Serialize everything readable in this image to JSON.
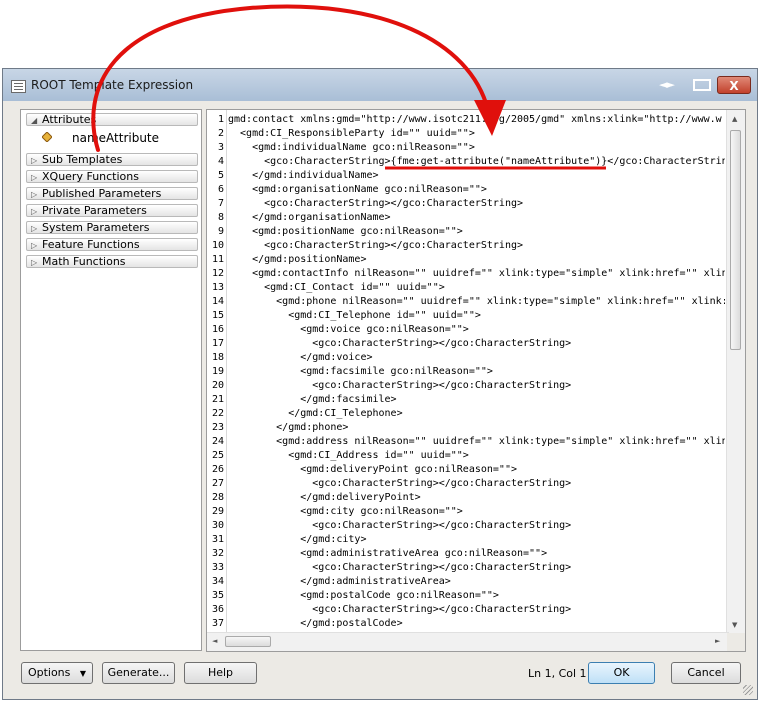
{
  "window": {
    "title": "ROOT Template Expression",
    "nav_arrows": "◄►",
    "close_label": "X"
  },
  "left_panel": {
    "categories": [
      {
        "label": "Attributes",
        "expanded": true
      },
      {
        "label": "Sub Templates",
        "expanded": false
      },
      {
        "label": "XQuery Functions",
        "expanded": false
      },
      {
        "label": "Published Parameters",
        "expanded": false
      },
      {
        "label": "Private Parameters",
        "expanded": false
      },
      {
        "label": "System Parameters",
        "expanded": false
      },
      {
        "label": "Feature Functions",
        "expanded": false
      },
      {
        "label": "Math Functions",
        "expanded": false
      }
    ],
    "attribute_items": [
      {
        "label": "nameAttribute",
        "icon": "attribute-diamond-icon"
      }
    ]
  },
  "editor": {
    "line_numbers": [
      "1",
      "2",
      "3",
      "4",
      "5",
      "6",
      "7",
      "8",
      "9",
      "10",
      "11",
      "12",
      "13",
      "14",
      "15",
      "16",
      "17",
      "18",
      "19",
      "20",
      "21",
      "22",
      "23",
      "24",
      "25",
      "26",
      "27",
      "28",
      "29",
      "30",
      "31",
      "32",
      "33",
      "34",
      "35",
      "36",
      "37"
    ],
    "lines": [
      "gmd:contact xmlns:gmd=\"http://www.isotc211.org/2005/gmd\" xmlns:xlink=\"http://www.w",
      "  <gmd:CI_ResponsibleParty id=\"\" uuid=\"\">",
      "    <gmd:individualName gco:nilReason=\"\">",
      "      <gco:CharacterString>{fme:get-attribute(\"nameAttribute\")}</gco:CharacterStrin",
      "    </gmd:individualName>",
      "    <gmd:organisationName gco:nilReason=\"\">",
      "      <gco:CharacterString></gco:CharacterString>",
      "    </gmd:organisationName>",
      "    <gmd:positionName gco:nilReason=\"\">",
      "      <gco:CharacterString></gco:CharacterString>",
      "    </gmd:positionName>",
      "    <gmd:contactInfo nilReason=\"\" uuidref=\"\" xlink:type=\"simple\" xlink:href=\"\" xlin",
      "      <gmd:CI_Contact id=\"\" uuid=\"\">",
      "        <gmd:phone nilReason=\"\" uuidref=\"\" xlink:type=\"simple\" xlink:href=\"\" xlink:",
      "          <gmd:CI_Telephone id=\"\" uuid=\"\">",
      "            <gmd:voice gco:nilReason=\"\">",
      "              <gco:CharacterString></gco:CharacterString>",
      "            </gmd:voice>",
      "            <gmd:facsimile gco:nilReason=\"\">",
      "              <gco:CharacterString></gco:CharacterString>",
      "            </gmd:facsimile>",
      "          </gmd:CI_Telephone>",
      "        </gmd:phone>",
      "        <gmd:address nilReason=\"\" uuidref=\"\" xlink:type=\"simple\" xlink:href=\"\" xlin",
      "          <gmd:CI_Address id=\"\" uuid=\"\">",
      "            <gmd:deliveryPoint gco:nilReason=\"\">",
      "              <gco:CharacterString></gco:CharacterString>",
      "            </gmd:deliveryPoint>",
      "            <gmd:city gco:nilReason=\"\">",
      "              <gco:CharacterString></gco:CharacterString>",
      "            </gmd:city>",
      "            <gmd:administrativeArea gco:nilReason=\"\">",
      "              <gco:CharacterString></gco:CharacterString>",
      "            </gmd:administrativeArea>",
      "            <gmd:postalCode gco:nilReason=\"\">",
      "              <gco:CharacterString></gco:CharacterString>",
      "            </gmd:postalCode>"
    ]
  },
  "footer": {
    "options_label": "Options",
    "generate_label": "Generate...",
    "help_label": "Help",
    "status": "Ln 1, Col 1",
    "ok_label": "OK",
    "cancel_label": "Cancel"
  },
  "colors": {
    "annotation": "#e0100c",
    "titlebar": "#b8cadf"
  }
}
